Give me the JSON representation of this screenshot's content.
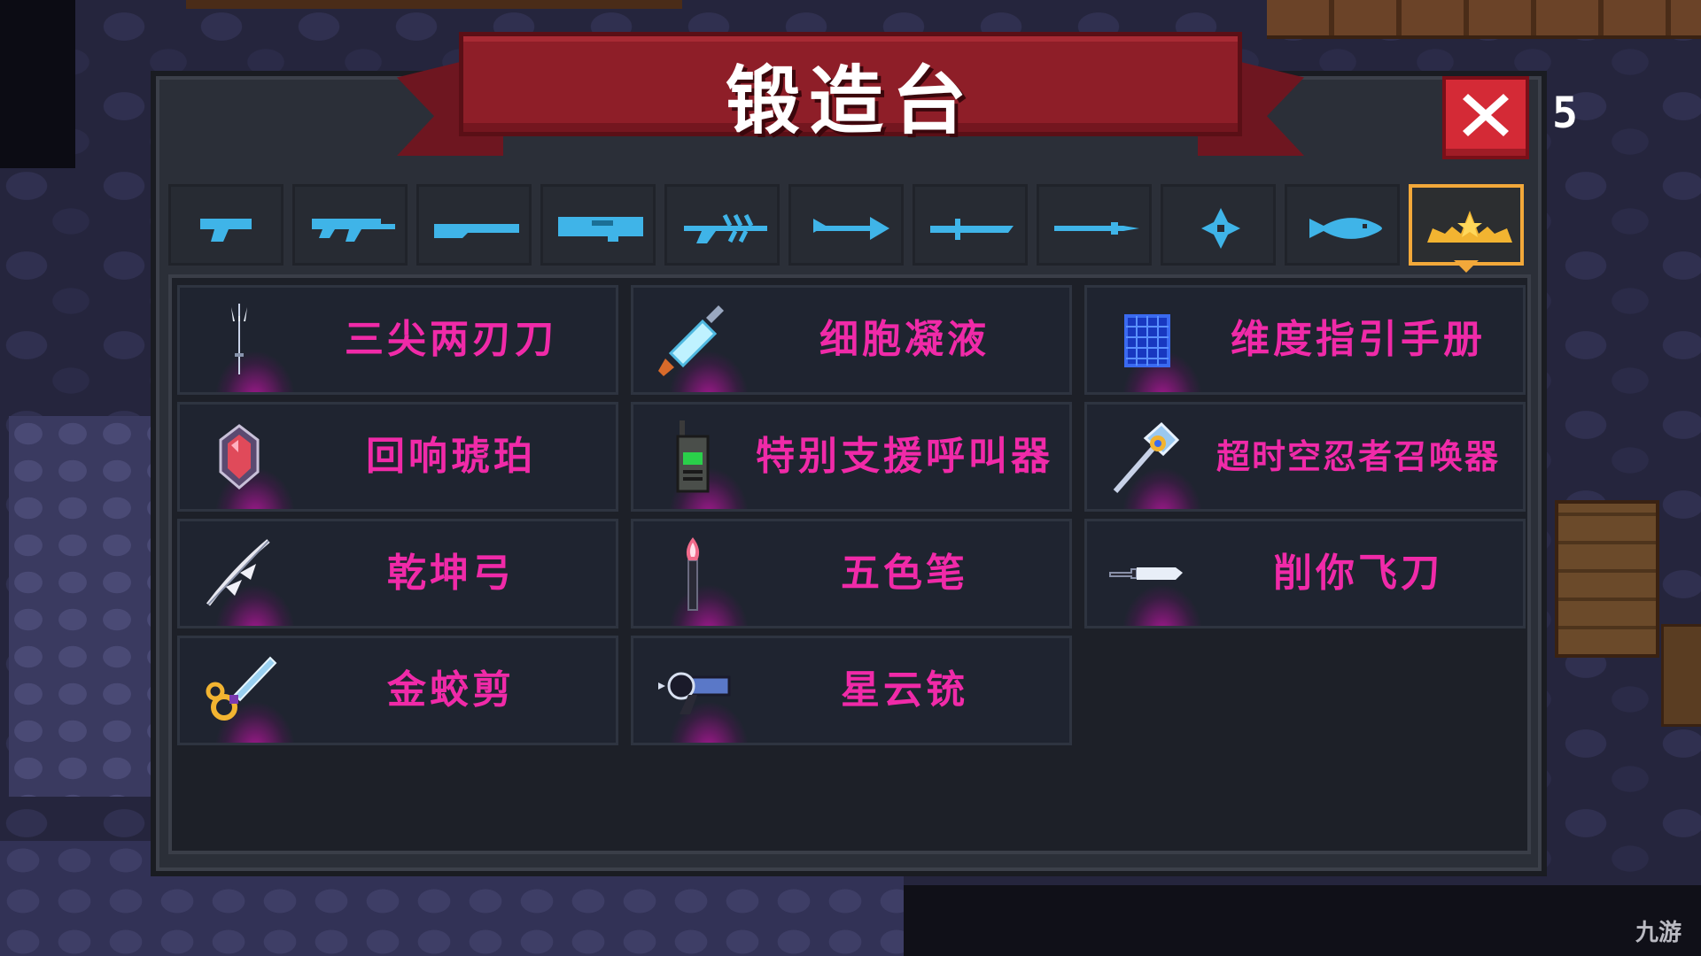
{
  "window": {
    "title": "锻造台"
  },
  "counter_digit": "5",
  "watermark": "九游",
  "close": {
    "icon": "close-icon"
  },
  "colors": {
    "banner": "#8e1e28",
    "accent_tab": "#f2a83a",
    "item_text": "#f02aa8",
    "tab_icon": "#3fb4e8"
  },
  "tabs": [
    {
      "icon": "pistol-icon"
    },
    {
      "icon": "rifle-icon"
    },
    {
      "icon": "shotgun-icon"
    },
    {
      "icon": "launcher-icon"
    },
    {
      "icon": "laser-gun-icon"
    },
    {
      "icon": "bow-icon"
    },
    {
      "icon": "sword-icon"
    },
    {
      "icon": "spear-icon"
    },
    {
      "icon": "shuriken-icon"
    },
    {
      "icon": "fish-icon"
    },
    {
      "icon": "stars-special-icon",
      "active": true
    }
  ],
  "items": [
    {
      "label": "三尖两刃刀",
      "icon": "trident-icon"
    },
    {
      "label": "细胞凝液",
      "icon": "syringe-icon"
    },
    {
      "label": "维度指引手册",
      "icon": "blue-grid-book-icon"
    },
    {
      "label": "回响琥珀",
      "icon": "amber-gem-icon"
    },
    {
      "label": "特别支援呼叫器",
      "icon": "walkie-talkie-icon"
    },
    {
      "label": "超时空忍者召唤器",
      "icon": "summoner-staff-icon"
    },
    {
      "label": "乾坤弓",
      "icon": "feather-bow-icon"
    },
    {
      "label": "五色笔",
      "icon": "brush-icon"
    },
    {
      "label": "削你飞刀",
      "icon": "throwing-knife-icon"
    },
    {
      "label": "金蛟剪",
      "icon": "golden-scissors-icon"
    },
    {
      "label": "星云铳",
      "icon": "nebula-gun-icon"
    }
  ]
}
